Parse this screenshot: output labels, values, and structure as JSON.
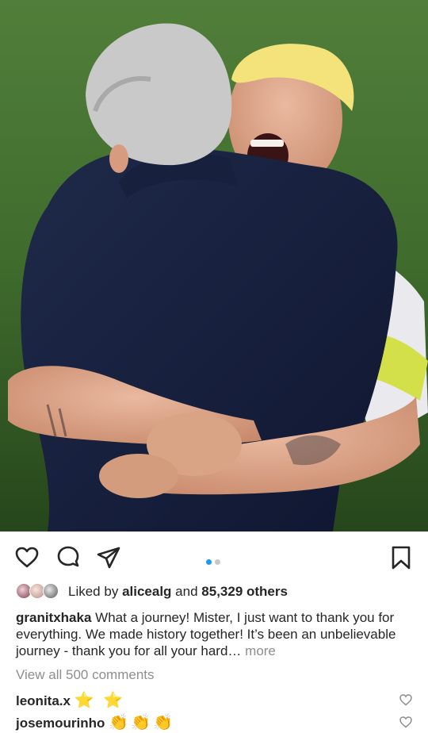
{
  "post": {
    "photo_alt": "Two men embracing on a football pitch",
    "carousel": {
      "count": 2,
      "active": 0
    },
    "likes": {
      "prefix": "Liked by",
      "user": "alicealg",
      "connector": "and",
      "others": "85,329 others"
    },
    "caption": {
      "username": "granitxhaka",
      "text": "What a journey! Mister, I just want to thank you for everything. We made history together! It’s been an unbelievable journey - thank you for all your hard…",
      "more_label": "more"
    },
    "view_all_label": "View all 500 comments",
    "comments": [
      {
        "username": "leonita.x",
        "text": "⭐ ⭐"
      },
      {
        "username": "josemourinho",
        "text": "👏👏👏"
      }
    ]
  },
  "colors": {
    "text": "#262626",
    "muted": "#8e8e8e",
    "dot_active": "#1d9bf0",
    "dot_inactive": "#c7c7c7"
  },
  "icons": [
    "heart-icon",
    "comment-icon",
    "share-icon",
    "bookmark-icon"
  ]
}
